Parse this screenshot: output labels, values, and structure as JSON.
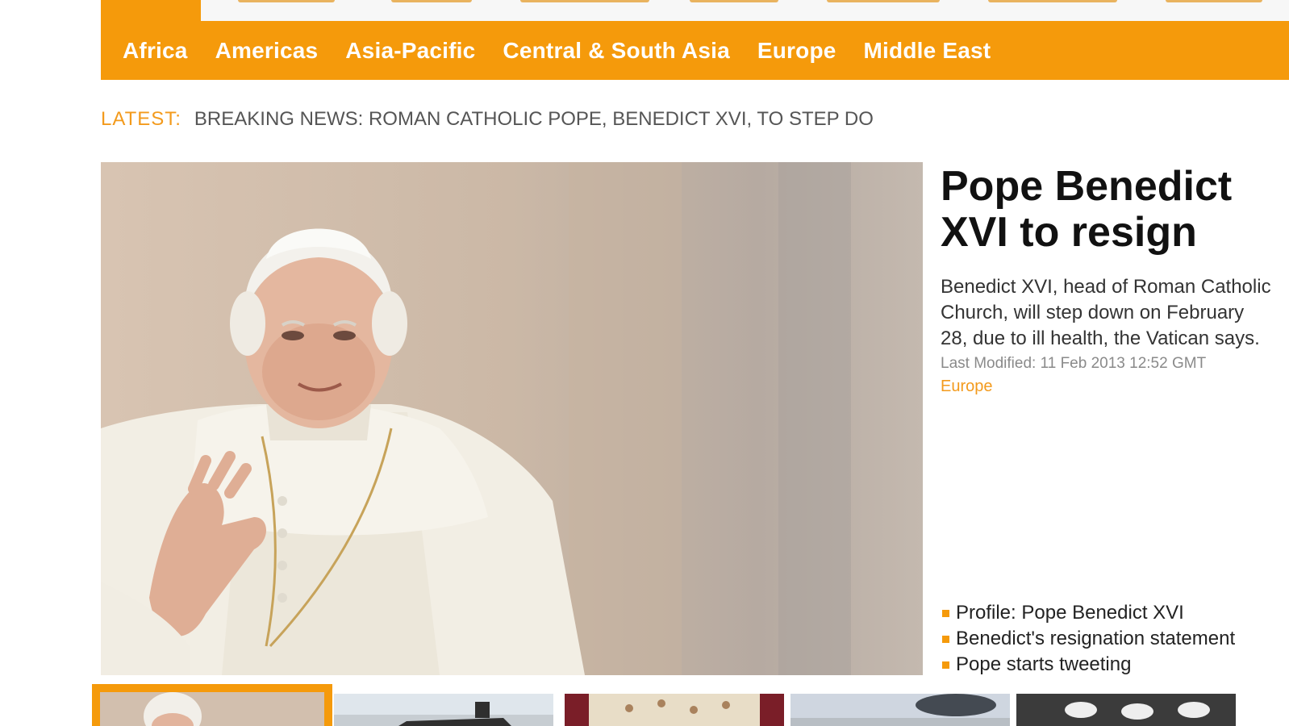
{
  "top_nav": {
    "active_tab": ""
  },
  "region_nav": {
    "items": [
      "Africa",
      "Americas",
      "Asia-Pacific",
      "Central & South Asia",
      "Europe",
      "Middle East"
    ]
  },
  "ticker": {
    "label": "LATEST:",
    "text": "BREAKING NEWS: ROMAN CATHOLIC POPE, BENEDICT XVI, TO STEP DO"
  },
  "featured": {
    "headline": "Pope Benedict XVI to resign",
    "summary": "Benedict XVI, head of Roman Catholic Church, will step down on February 28, due to ill health, the Vatican says.",
    "last_modified": "Last Modified: 11 Feb 2013 12:52 GMT",
    "category": "Europe",
    "related_links": [
      "Profile: Pope Benedict XVI",
      "Benedict's resignation statement",
      "Pope starts tweeting"
    ]
  },
  "colors": {
    "accent": "#f59a0b",
    "text": "#111111",
    "muted": "#8a8a8a"
  }
}
